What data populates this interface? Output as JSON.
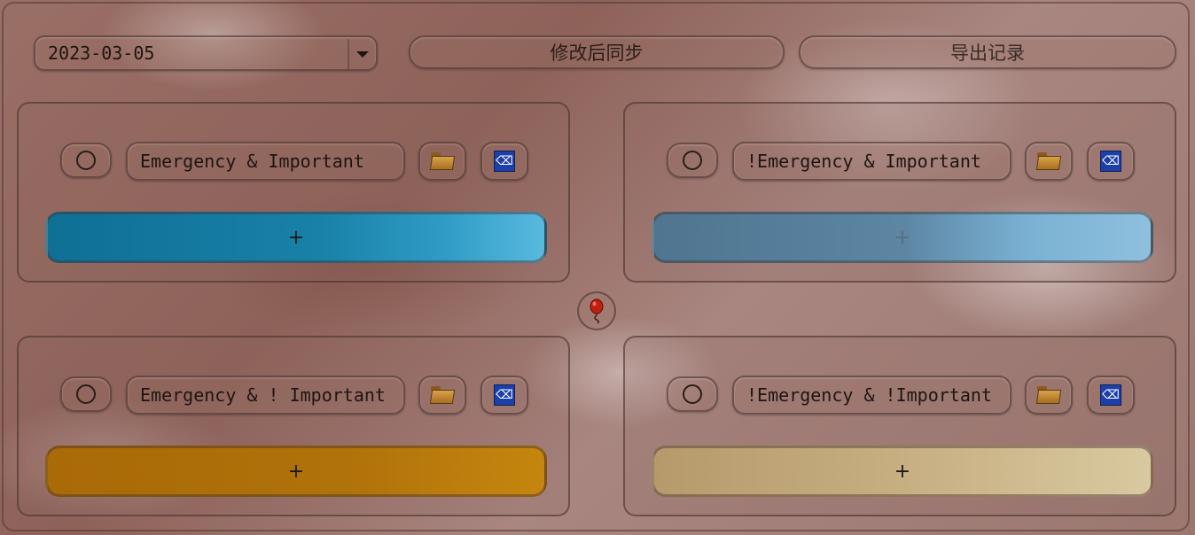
{
  "toolbar": {
    "date_value": "2023-03-05",
    "sync_label": "修改后同步",
    "export_label": "导出记录"
  },
  "quadrants": [
    {
      "title": "Emergency & Important",
      "add_label": "+",
      "color": "#1581a8"
    },
    {
      "title": "!Emergency & Important",
      "add_label": "+",
      "color": "#6f9ec0"
    },
    {
      "title": "Emergency & ! Important",
      "add_label": "+",
      "color": "#b0720a"
    },
    {
      "title": "!Emergency & !Important",
      "add_label": "+",
      "color": "#cbb68a"
    }
  ],
  "icons": {
    "status": "circle-icon",
    "folder": "folder-icon",
    "trash": "trash-icon",
    "center": "balloon-icon"
  }
}
